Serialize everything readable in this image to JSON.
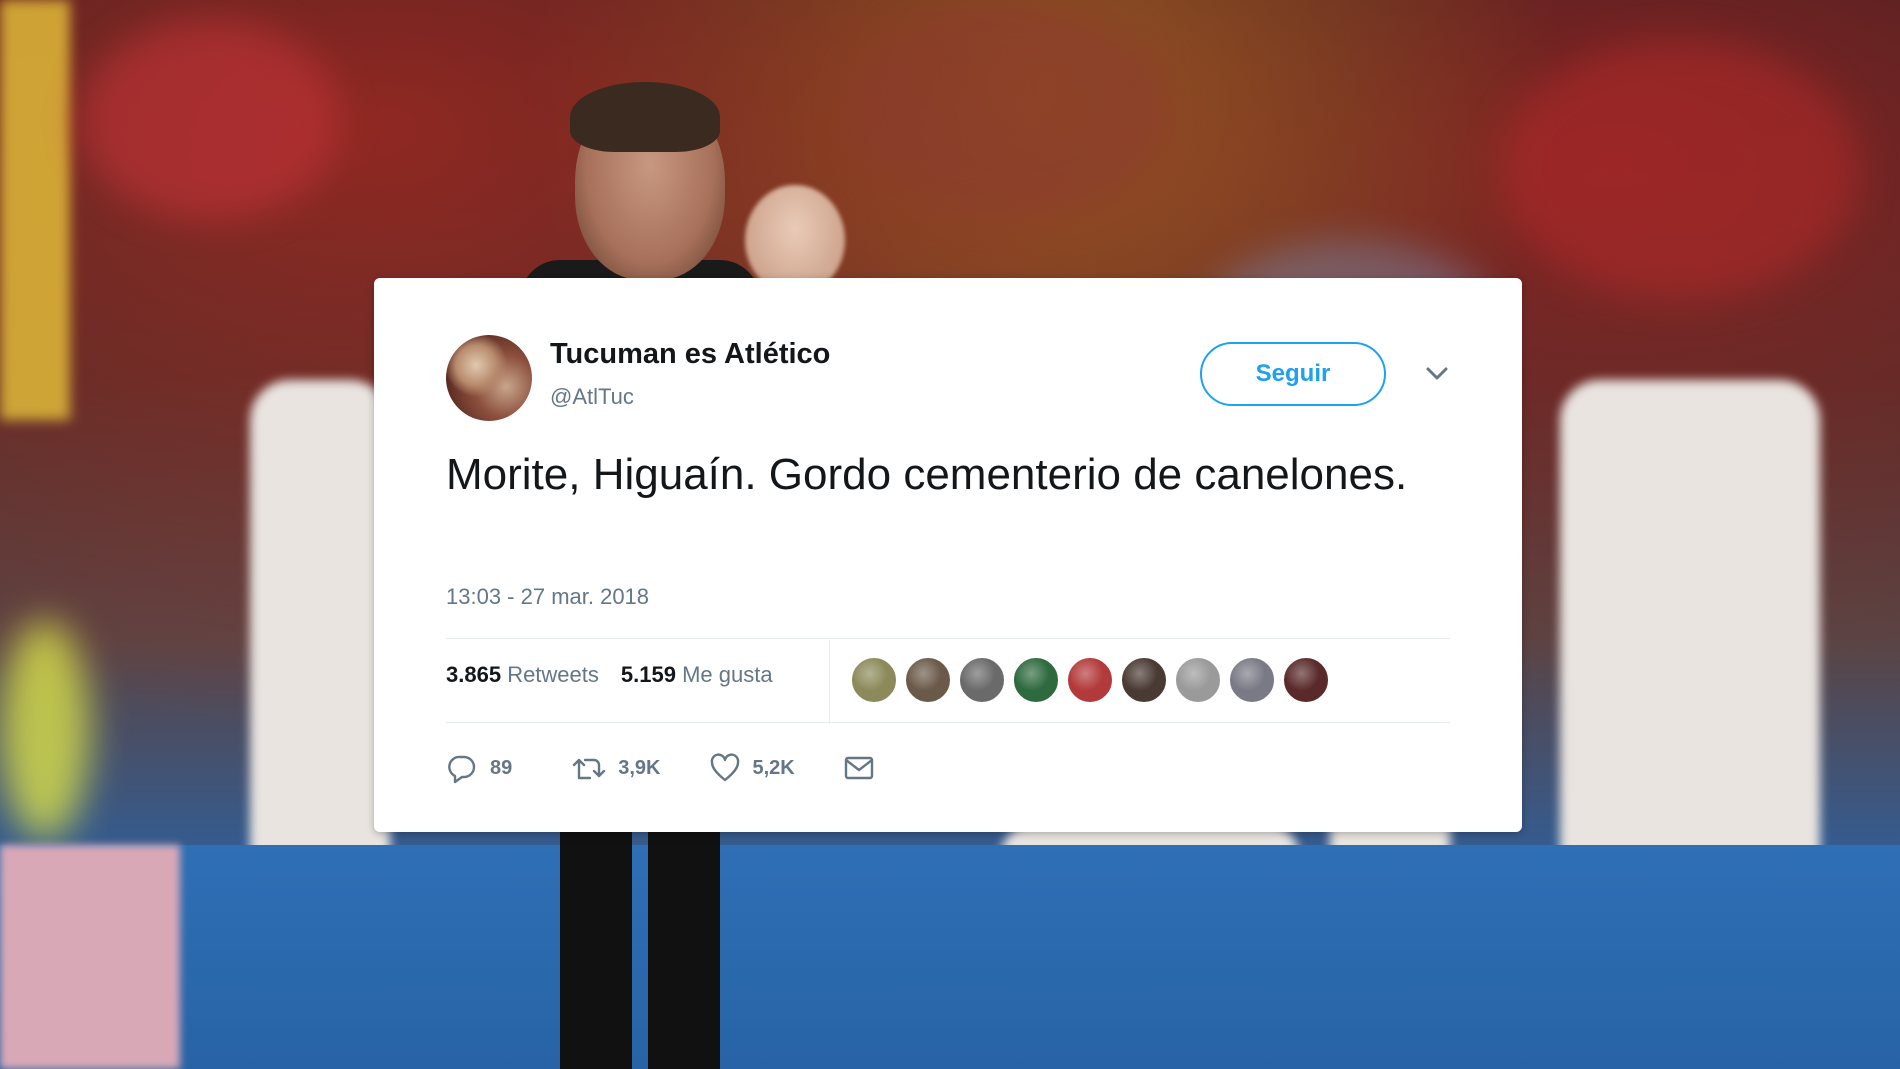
{
  "tweet": {
    "author_name": "Tucuman es Atlético",
    "author_handle": "@AtlTuc",
    "follow_label": "Seguir",
    "text": "Morite, Higuaín. Gordo cementerio de canelones.",
    "timestamp": "13:03 - 27 mar. 2018",
    "stats": {
      "retweets_count": "3.865",
      "retweets_label": "Retweets",
      "likes_count": "5.159",
      "likes_label": "Me gusta"
    },
    "likers": [
      {
        "color": "#8c8a5a"
      },
      {
        "color": "#6b5a4a"
      },
      {
        "color": "#6a6a6a"
      },
      {
        "color": "#2f6a3f"
      },
      {
        "color": "#b33a3a"
      },
      {
        "color": "#4a3a34"
      },
      {
        "color": "#9a9a9a"
      },
      {
        "color": "#7a7a86"
      },
      {
        "color": "#5a2a2a"
      }
    ],
    "actions": {
      "reply_count": "89",
      "retweet_count": "3,9K",
      "like_count": "5,2K"
    },
    "accent_color": "#1da1f2",
    "icons": [
      "chevron-down-icon",
      "reply-icon",
      "retweet-icon",
      "heart-icon",
      "mail-icon"
    ]
  }
}
